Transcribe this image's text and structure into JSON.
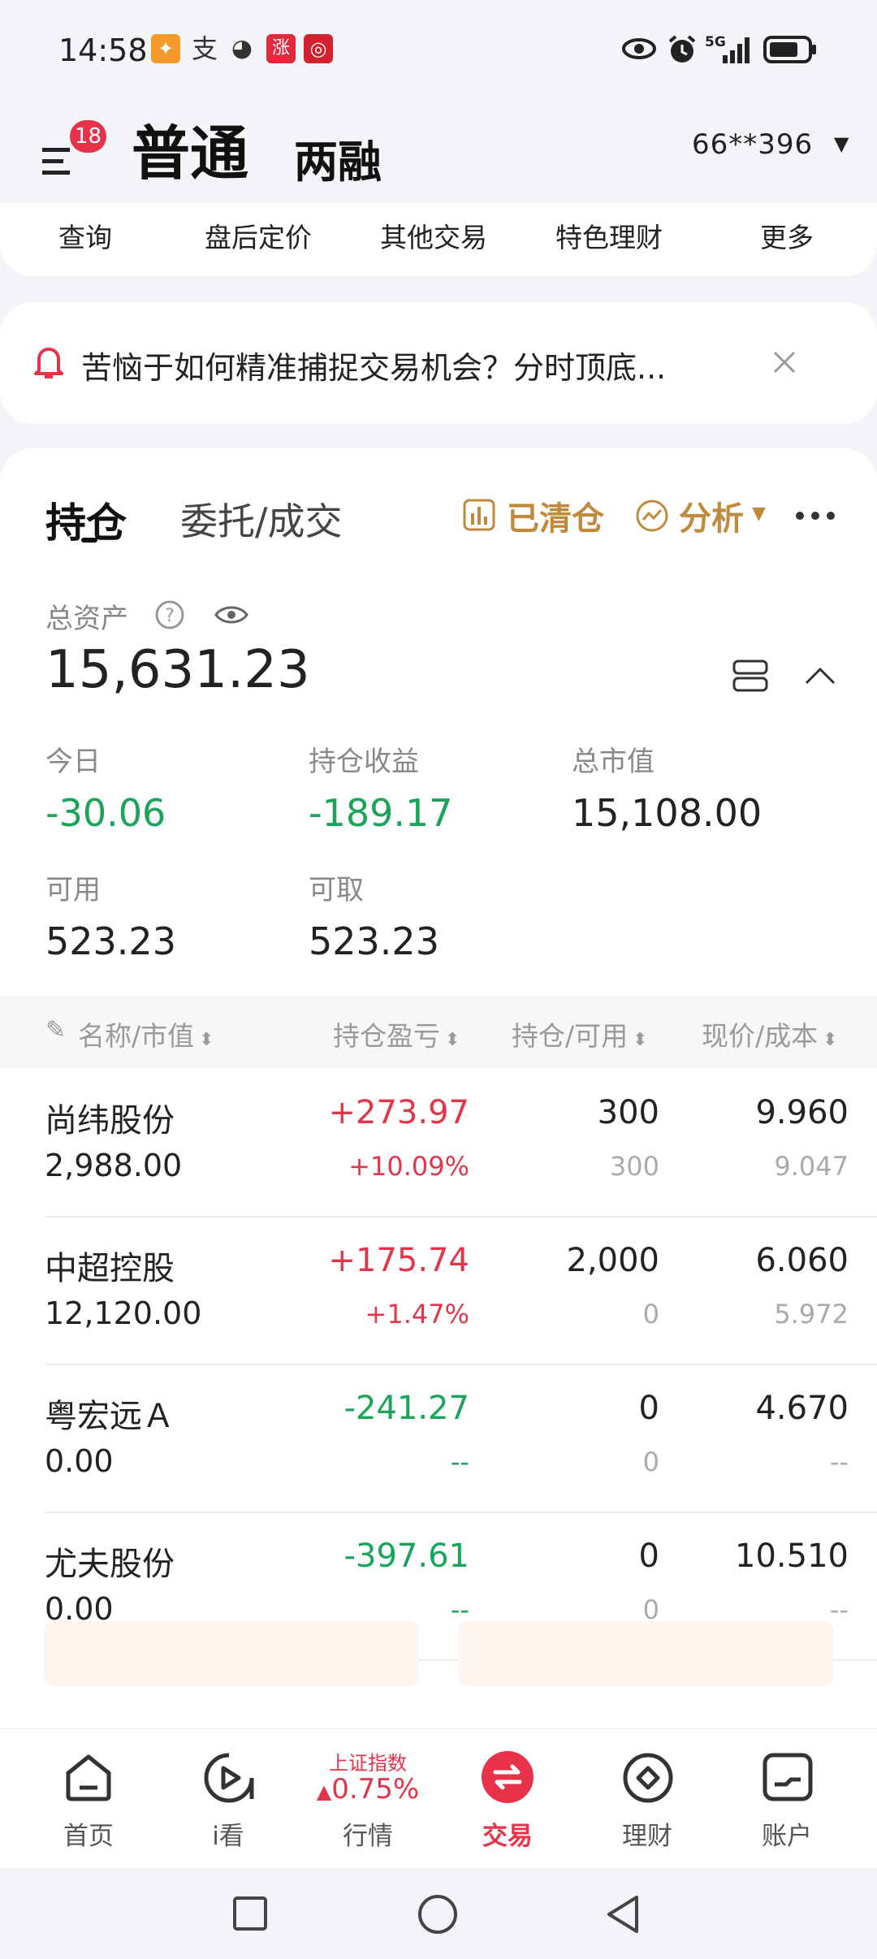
{
  "status_bar": {
    "time": "14:58",
    "app_icons": [
      "taobao-icon",
      "alipay-icon",
      "wechat-icon",
      "zhang-icon",
      "bank-icon"
    ],
    "right_icons": [
      "eye-icon",
      "alarm-icon",
      "signal-5g-icon",
      "battery-icon"
    ],
    "network": "5G"
  },
  "header": {
    "badge_count": "18",
    "tab_normal": "普通",
    "tab_margin": "两融",
    "account": "66**396"
  },
  "sub_menu": {
    "items": [
      "查询",
      "盘后定价",
      "其他交易",
      "特色理财",
      "更多"
    ]
  },
  "notice": {
    "text": "苦恼于如何精准捕捉交易机会？分时顶底..."
  },
  "position_card": {
    "tab_positions": "持仓",
    "tab_orders": "委托/成交",
    "cleared_label": "已清仓",
    "analysis_label": "分析",
    "total_assets_label": "总资产",
    "total_assets_value": "15,631.23",
    "today_label": "今日",
    "today_value": "-30.06",
    "holding_pl_label": "持仓收益",
    "holding_pl_value": "-189.17",
    "market_value_label": "总市值",
    "market_value_value": "15,108.00",
    "available_label": "可用",
    "available_value": "523.23",
    "withdrawable_label": "可取",
    "withdrawable_value": "523.23"
  },
  "table": {
    "headers": [
      "名称/市值",
      "持仓盈亏",
      "持仓/可用",
      "现价/成本"
    ],
    "rows": [
      {
        "name": "尚纬股份",
        "market_value": "2,988.00",
        "pl": "+273.97",
        "pl_pct": "+10.09%",
        "holding": "300",
        "available": "300",
        "price": "9.960",
        "cost": "9.047",
        "trend": "up"
      },
      {
        "name": "中超控股",
        "market_value": "12,120.00",
        "pl": "+175.74",
        "pl_pct": "+1.47%",
        "holding": "2,000",
        "available": "0",
        "price": "6.060",
        "cost": "5.972",
        "trend": "up"
      },
      {
        "name": "粤宏远Ａ",
        "market_value": "0.00",
        "pl": "-241.27",
        "pl_pct": "--",
        "holding": "0",
        "available": "0",
        "price": "4.670",
        "cost": "--",
        "trend": "down"
      },
      {
        "name": "尤夫股份",
        "market_value": "0.00",
        "pl": "-397.61",
        "pl_pct": "--",
        "holding": "0",
        "available": "0",
        "price": "10.510",
        "cost": "--",
        "trend": "down"
      }
    ]
  },
  "bottom_nav": {
    "items": [
      {
        "label": "首页",
        "icon": "home-icon"
      },
      {
        "label": "i看",
        "icon": "play-icon"
      },
      {
        "label": "行情",
        "icon": "market-icon"
      },
      {
        "label": "交易",
        "icon": "trade-icon"
      },
      {
        "label": "理财",
        "icon": "finance-icon"
      },
      {
        "label": "账户",
        "icon": "account-icon"
      }
    ],
    "index_name": "上证指数",
    "index_change": "0.75%"
  },
  "colors": {
    "up": "#e1354a",
    "down": "#1ba35a",
    "accent_gold": "#c08a3e",
    "brand_red": "#e8324a"
  }
}
